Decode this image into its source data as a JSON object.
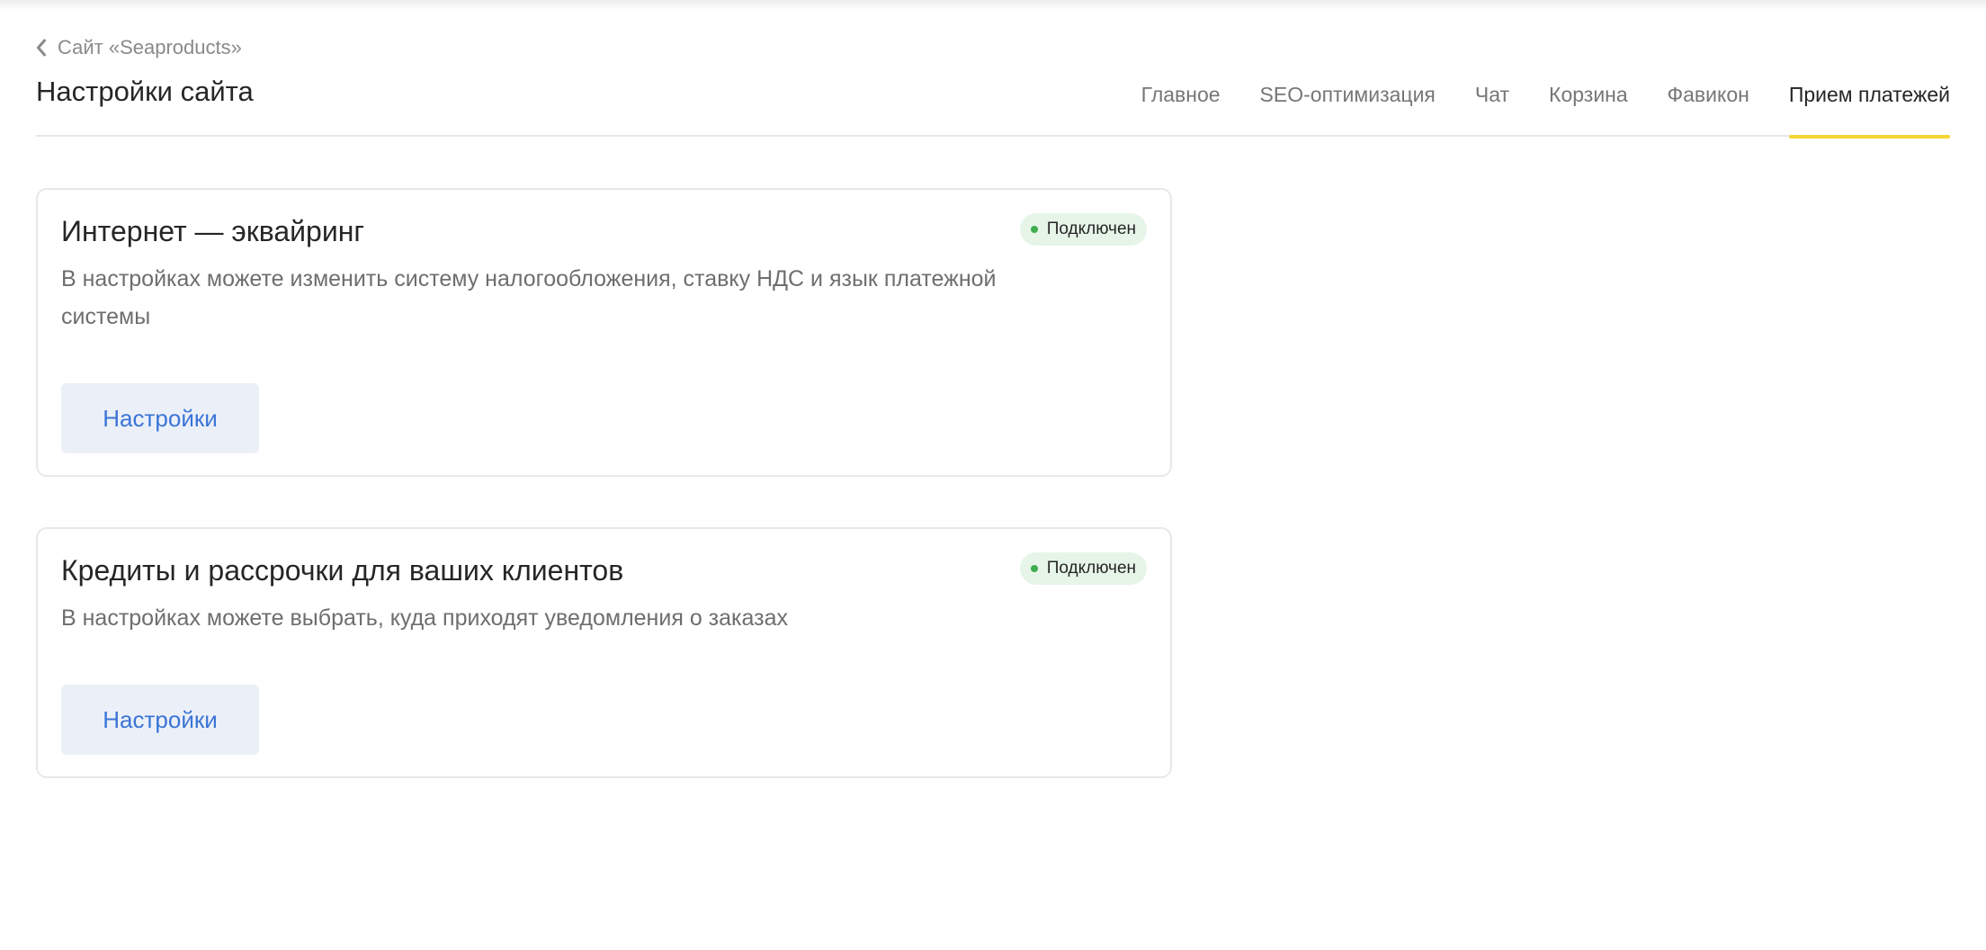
{
  "header": {
    "back_label": "Сайт «Seaproducts»",
    "title": "Настройки сайта",
    "tabs": [
      {
        "label": "Главное"
      },
      {
        "label": "SEO-оптимизация"
      },
      {
        "label": "Чат"
      },
      {
        "label": "Корзина"
      },
      {
        "label": "Фавикон"
      },
      {
        "label": "Прием платежей"
      }
    ],
    "active_tab": "Прием платежей",
    "accent_color": "#f5d634"
  },
  "cards": [
    {
      "title": "Интернет — эквайринг",
      "description": "В настройках можете изменить систему налогообложения, ставку НДС и язык платежной системы",
      "status": "Подключен",
      "button_label": "Настройки"
    },
    {
      "title": "Кредиты и рассрочки для ваших клиентов",
      "description": "В настройках можете выбрать, куда приходят уведомления о заказах",
      "status": "Подключен",
      "button_label": "Настройки"
    }
  ],
  "colors": {
    "status_bg": "#e6f5e8",
    "status_dot": "#3fae50",
    "button_bg": "#ebf0f8",
    "button_text": "#3b74d6"
  },
  "icons": {
    "back": "chevron-left-icon",
    "status": "status-dot-icon"
  }
}
